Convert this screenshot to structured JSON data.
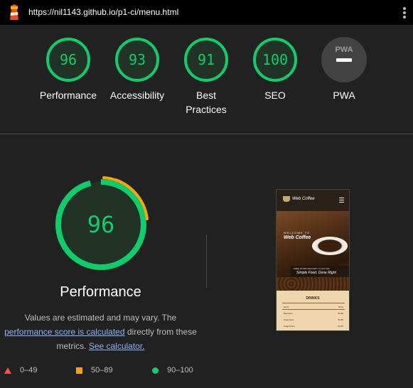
{
  "header": {
    "url": "https://nil1143.github.io/p1-ci/menu.html",
    "logo_icon": "lighthouse-icon",
    "menu_icon": "kebab-menu-icon"
  },
  "scores": [
    {
      "value": "96",
      "label": "Performance"
    },
    {
      "value": "93",
      "label": "Accessibility"
    },
    {
      "value": "91",
      "label": "Best Practices"
    },
    {
      "value": "100",
      "label": "SEO"
    },
    {
      "value": "",
      "label": "PWA",
      "badge": "PWA"
    }
  ],
  "performance": {
    "score": "96",
    "title": "Performance",
    "note_start": "Values are estimated and may vary. The",
    "link1": "performance score is calculated",
    "note_mid": "directly from these metrics.",
    "link2": "See calculator."
  },
  "screenshot": {
    "brand": "Web Coffee",
    "welcome": "WELCOME TO",
    "hero_title": "Web Coffee",
    "band_small": "FREE 20-MIN DELIVERY & 10% OFF",
    "band_big": "Simple Food, Done Right",
    "section": "DRINKS",
    "col1": "Items",
    "col2": "Price",
    "rows": [
      {
        "item": "Espresso",
        "price": "€2.80"
      },
      {
        "item": "Americano",
        "price": "€2.80"
      },
      {
        "item": "Cappuccino",
        "price": "€3.40"
      }
    ]
  },
  "legend": [
    {
      "label": "0–49",
      "icon": "triangle-fail-icon",
      "color": "#ff4e42"
    },
    {
      "label": "50–89",
      "icon": "square-average-icon",
      "color": "#ffa400"
    },
    {
      "label": "90–100",
      "icon": "circle-pass-icon",
      "color": "#0cce6b"
    }
  ],
  "colors": {
    "pass": "#0cce6b",
    "average": "#ffa400",
    "fail": "#ff4e42",
    "link": "#8ab4f8"
  }
}
